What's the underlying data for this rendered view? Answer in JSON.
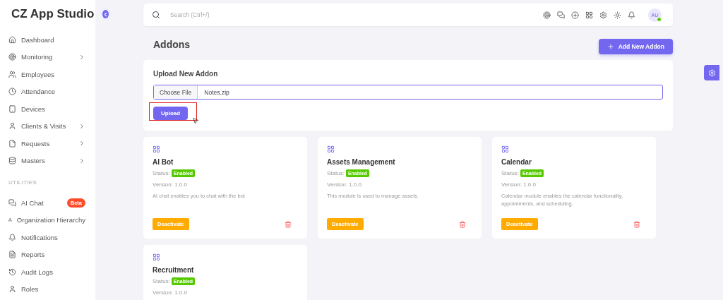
{
  "sidebar": {
    "brand": "CZ App Studio",
    "items": [
      {
        "label": "Dashboard",
        "has_submenu": false
      },
      {
        "label": "Monitoring",
        "has_submenu": true
      },
      {
        "label": "Employees",
        "has_submenu": false
      },
      {
        "label": "Attendance",
        "has_submenu": false
      },
      {
        "label": "Devices",
        "has_submenu": false
      },
      {
        "label": "Clients & Visits",
        "has_submenu": true
      },
      {
        "label": "Requests",
        "has_submenu": true
      },
      {
        "label": "Masters",
        "has_submenu": true
      }
    ],
    "section": "UTILITIES",
    "utilities": [
      {
        "label": "AI Chat",
        "badge": "Beta"
      },
      {
        "label": "Organization Hierarchy"
      },
      {
        "label": "Notifications"
      },
      {
        "label": "Reports"
      },
      {
        "label": "Audit Logs"
      },
      {
        "label": "Roles"
      }
    ]
  },
  "topbar": {
    "search_placeholder": "Search (Ctrl+/)",
    "avatar": "AU",
    "online": true
  },
  "page": {
    "title": "Addons",
    "add_button": "Add New Addon"
  },
  "upload": {
    "title": "Upload New Addon",
    "choose_file": "Choose File",
    "file_name": "Notes.zip",
    "button": "Upload",
    "highlighted": true
  },
  "addons": [
    {
      "name": "AI Bot",
      "status_label": "Status:",
      "status": "Enabled",
      "version": "Version: 1.0.0",
      "description": "AI chat enables you to chat with the bot",
      "action": "Deactivate"
    },
    {
      "name": "Assets Management",
      "status_label": "Status:",
      "status": "Enabled",
      "version": "Version: 1.0.0",
      "description": "This module is used to manage assets.",
      "action": "Deactivate"
    },
    {
      "name": "Calendar",
      "status_label": "Status:",
      "status": "Enabled",
      "version": "Version: 1.0.0",
      "description": "Calendar module enables the calendar functionality, appointments, and scheduling.",
      "action": "Deactivate"
    },
    {
      "name": "Recruitment",
      "status_label": "Status:",
      "status": "Enabled",
      "version": "Version: 1.0.0"
    }
  ]
}
